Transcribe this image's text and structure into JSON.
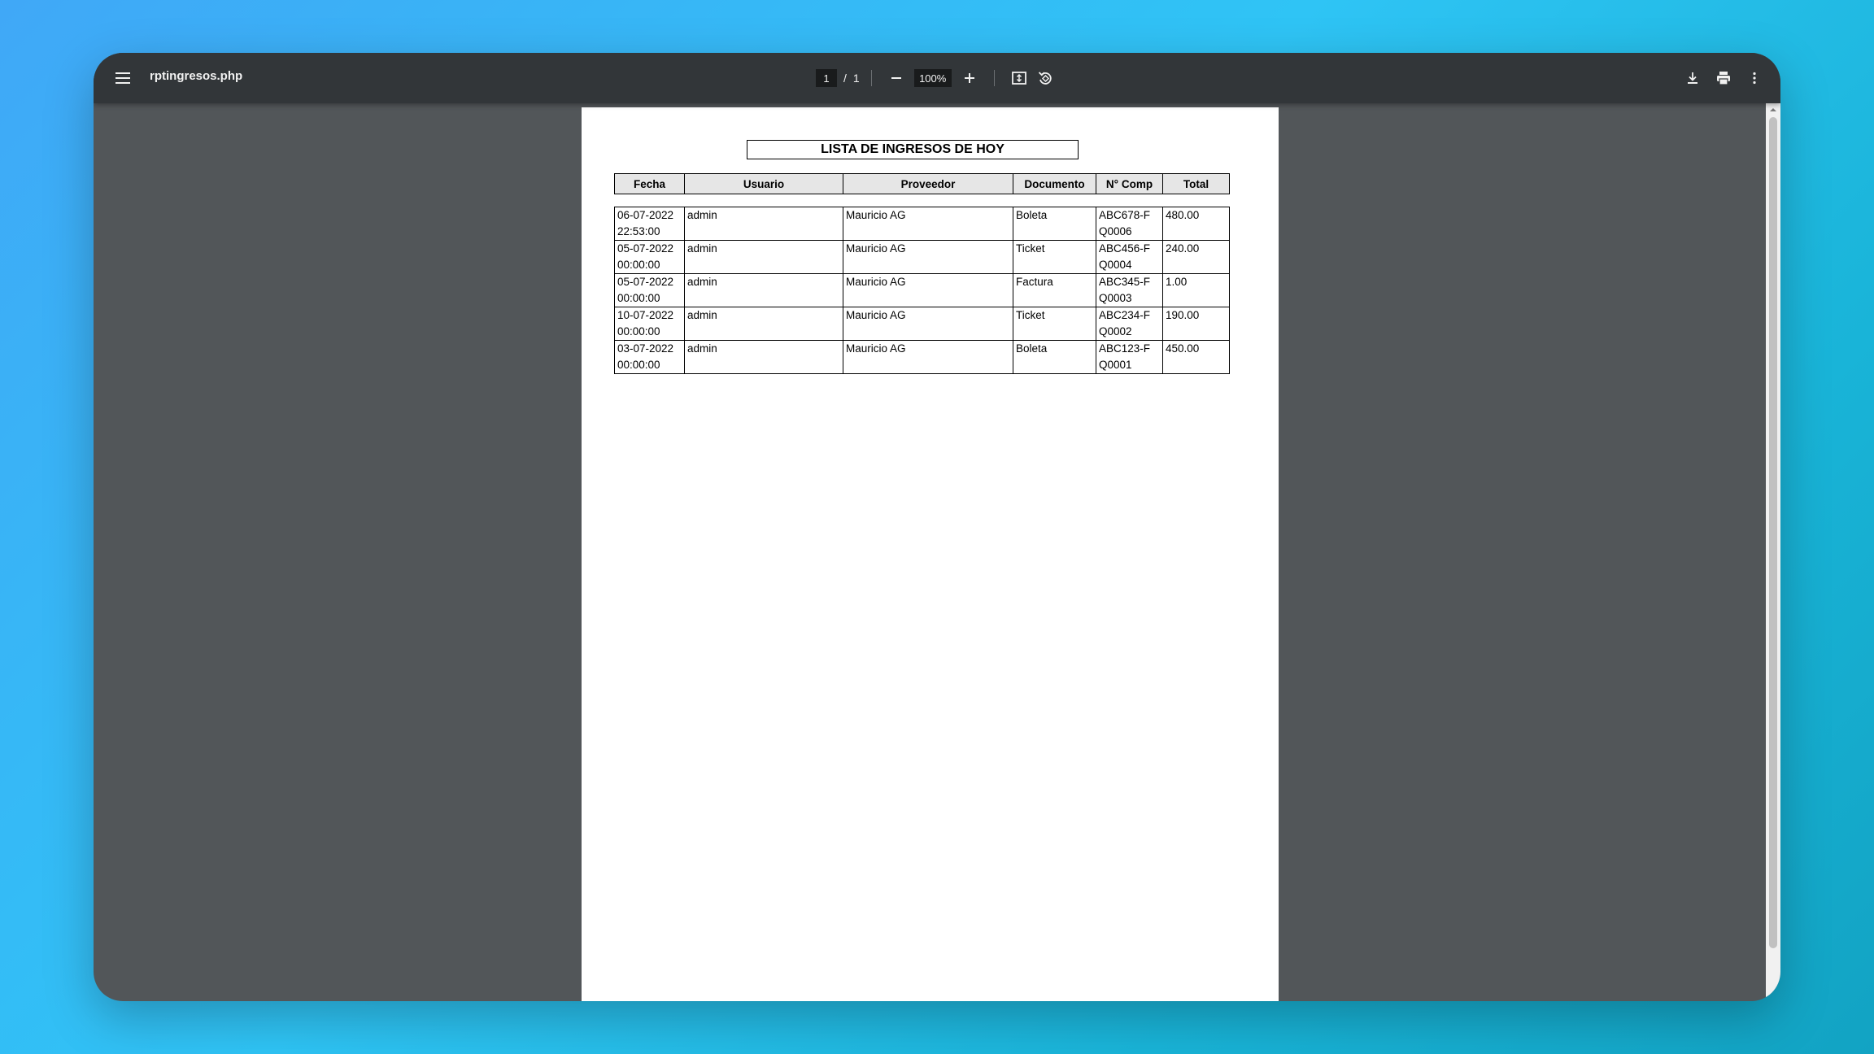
{
  "toolbar": {
    "menu_icon": "hamburger-menu-icon",
    "title": "rptingresos.php",
    "page_current": "1",
    "page_separator": "/",
    "page_total": "1",
    "zoom_value": "100%",
    "icons": {
      "zoom_out": "minus-icon",
      "zoom_in": "plus-icon",
      "fit": "fit-to-page-icon",
      "rotate": "rotate-icon",
      "download": "download-icon",
      "print": "print-icon",
      "more": "more-vertical-icon"
    }
  },
  "document": {
    "title": "LISTA DE INGRESOS DE HOY",
    "columns": [
      "Fecha",
      "Usuario",
      "Proveedor",
      "Documento",
      "N° Comp",
      "Total"
    ],
    "rows": [
      {
        "fecha": "06-07-2022\n22:53:00",
        "usuario": "admin",
        "proveedor": "Mauricio AG",
        "documento": "Boleta",
        "comp": "ABC678-F\nQ0006",
        "total": "480.00"
      },
      {
        "fecha": "05-07-2022\n00:00:00",
        "usuario": "admin",
        "proveedor": "Mauricio AG",
        "documento": "Ticket",
        "comp": "ABC456-F\nQ0004",
        "total": "240.00"
      },
      {
        "fecha": "05-07-2022\n00:00:00",
        "usuario": "admin",
        "proveedor": "Mauricio AG",
        "documento": "Factura",
        "comp": "ABC345-F\nQ0003",
        "total": "1.00"
      },
      {
        "fecha": "10-07-2022\n00:00:00",
        "usuario": "admin",
        "proveedor": "Mauricio AG",
        "documento": "Ticket",
        "comp": "ABC234-F\nQ0002",
        "total": "190.00"
      },
      {
        "fecha": "03-07-2022\n00:00:00",
        "usuario": "admin",
        "proveedor": "Mauricio AG",
        "documento": "Boleta",
        "comp": "ABC123-F\nQ0001",
        "total": "450.00"
      }
    ]
  },
  "colors": {
    "toolbar_bg": "#323639",
    "viewer_bg": "#525659",
    "header_cell_bg": "#e6e6e6"
  }
}
